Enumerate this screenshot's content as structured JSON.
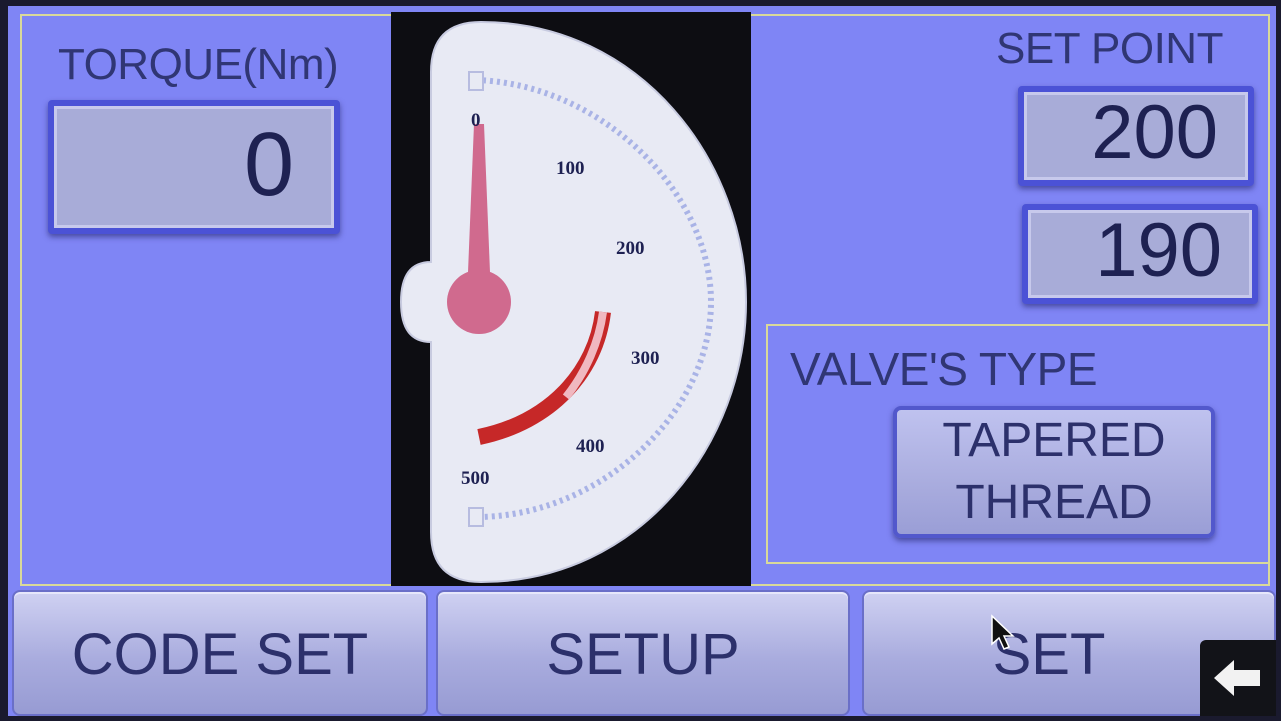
{
  "torque": {
    "label": "TORQUE(Nm)",
    "value": "0"
  },
  "set_point": {
    "label": "SET POINT",
    "upper_value": "200",
    "lower_value": "190"
  },
  "gauge": {
    "ticks": [
      "0",
      "100",
      "200",
      "300",
      "400",
      "500"
    ],
    "needle_value": 0,
    "needle_color": "#d06a8e",
    "red_zone_color": "#c62828"
  },
  "valve": {
    "label": "VALVE'S TYPE",
    "type_line1": "TAPERED",
    "type_line2": "THREAD"
  },
  "buttons": {
    "code_set": "CODE SET",
    "setup": "SETUP",
    "set": "SET"
  },
  "icons": {
    "back": "arrow-left-icon",
    "cursor": "mouse-pointer-icon"
  },
  "colors": {
    "screen_bg": "#7f85f5",
    "text": "#303674",
    "box_border": "#4b52d6",
    "frame": "#d9d99a"
  }
}
